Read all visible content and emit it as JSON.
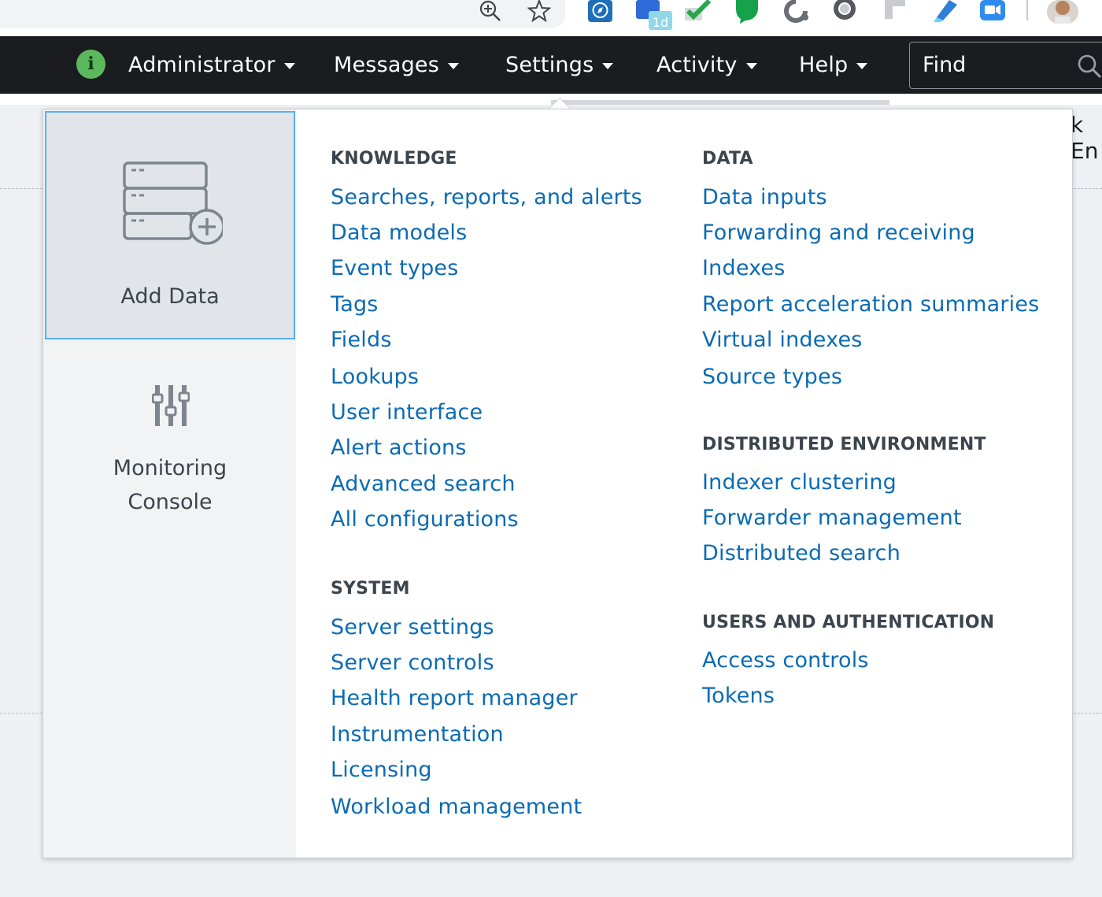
{
  "nav": {
    "items": [
      {
        "label": "Administrator"
      },
      {
        "label": "Messages"
      },
      {
        "label": "Settings"
      },
      {
        "label": "Activity"
      },
      {
        "label": "Help"
      }
    ],
    "find_placeholder": "Find"
  },
  "chrome": {
    "extension_badge": "1d"
  },
  "background_text": "k En",
  "left_panel": {
    "add_data_label": "Add Data",
    "monitoring_line1": "Monitoring",
    "monitoring_line2": "Console"
  },
  "knowledge": {
    "title": "KNOWLEDGE",
    "links": [
      "Searches, reports, and alerts",
      "Data models",
      "Event types",
      "Tags",
      "Fields",
      "Lookups",
      "User interface",
      "Alert actions",
      "Advanced search",
      "All configurations"
    ]
  },
  "system": {
    "title": "SYSTEM",
    "links": [
      "Server settings",
      "Server controls",
      "Health report manager",
      "Instrumentation",
      "Licensing",
      "Workload management"
    ]
  },
  "data": {
    "title": "DATA",
    "links": [
      "Data inputs",
      "Forwarding and receiving",
      "Indexes",
      "Report acceleration summaries",
      "Virtual indexes",
      "Source types"
    ]
  },
  "distributed": {
    "title": "DISTRIBUTED ENVIRONMENT",
    "links": [
      "Indexer clustering",
      "Forwarder management",
      "Distributed search"
    ]
  },
  "users": {
    "title": "USERS AND AUTHENTICATION",
    "links": [
      "Access controls",
      "Tokens"
    ]
  },
  "colors": {
    "nav_bg": "#1a1c20",
    "link": "#0b6bb3",
    "info_badge": "#5cb85c",
    "selected_border": "#5aaef0"
  },
  "icons": [
    "zoom-in-icon",
    "star-icon",
    "compass-icon",
    "calendar-icon",
    "checkmark-icon",
    "chat-bubble-icon",
    "circle-arrow-icon",
    "ring-icon",
    "sticky-note-icon",
    "highlighter-icon",
    "video-camera-icon",
    "avatar",
    "info-icon",
    "search-icon",
    "add-data-icon",
    "sliders-icon"
  ]
}
